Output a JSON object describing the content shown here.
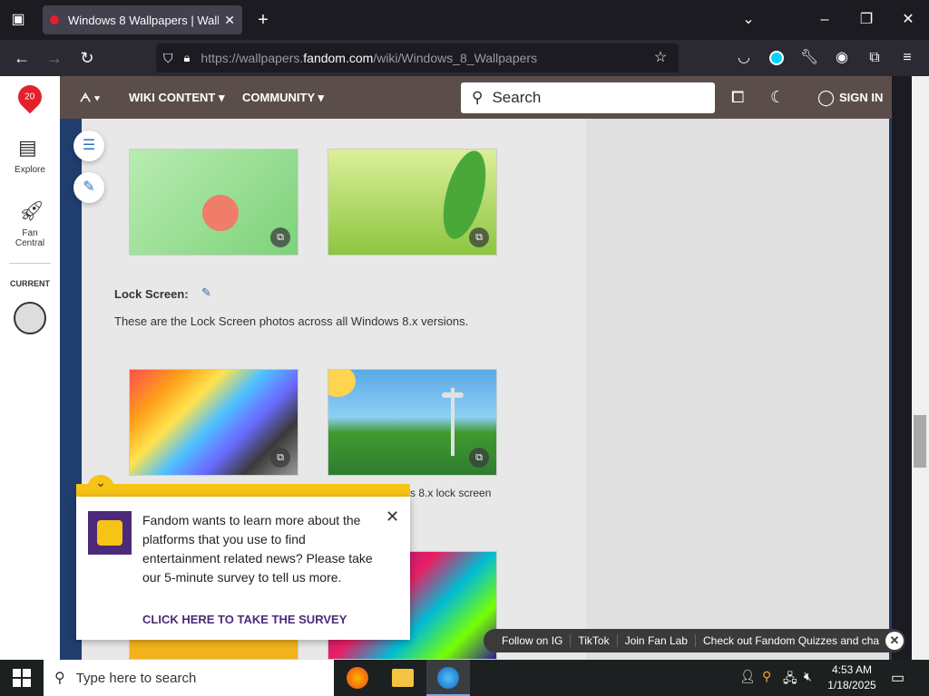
{
  "browser": {
    "tab_title": "Windows 8 Wallpapers | Wallpa",
    "url_prefix": "https://wallpapers.",
    "url_domain": "fandom.com",
    "url_path": "/wiki/Windows_8_Wallpapers"
  },
  "fandom": {
    "nav": [
      "WIKI CONTENT",
      "COMMUNITY"
    ],
    "search_placeholder": "Search",
    "sign_in": "SIGN IN",
    "rail": {
      "explore": "Explore",
      "fan_central_1": "Fan",
      "fan_central_2": "Central",
      "current": "CURRENT"
    }
  },
  "article": {
    "section_title": "Lock Screen:",
    "section_text": "These are the Lock Screen photos across all Windows 8.x versions.",
    "caption_partial": "s 8.x lock screen"
  },
  "survey": {
    "text": "Fandom wants to learn more about the platforms that you use to find entertainment related news? Please take our 5-minute survey to tell us more.",
    "cta": "CLICK HERE TO TAKE THE SURVEY"
  },
  "bottom_bar": [
    "Follow on IG",
    "TikTok",
    "Join Fan Lab",
    "Check out Fandom Quizzes and cha"
  ],
  "taskbar": {
    "search": "Type here to search",
    "time": "4:53 AM",
    "date": "1/18/2025"
  }
}
